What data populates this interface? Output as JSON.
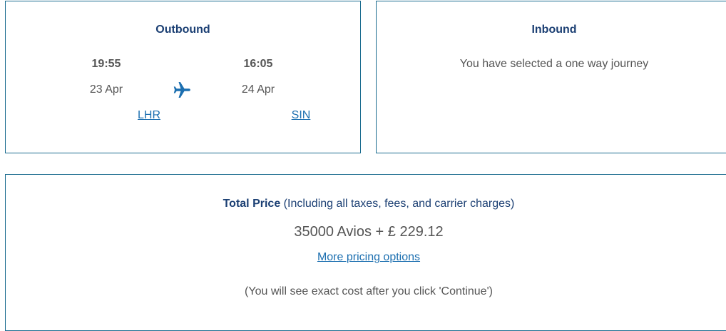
{
  "outbound": {
    "title": "Outbound",
    "departure": {
      "time": "19:55",
      "date": "23 Apr",
      "airport": "LHR"
    },
    "arrival": {
      "time": "16:05",
      "date": "24 Apr",
      "airport": "SIN"
    },
    "icon": "airplane-icon"
  },
  "inbound": {
    "title": "Inbound",
    "message": "You have selected a one way journey"
  },
  "price": {
    "label": "Total Price",
    "note": "(Including all taxes, fees, and carrier charges)",
    "amount": "35000 Avios + £ 229.12",
    "more_options": "More pricing options",
    "cost_note": "(You will see exact cost after you click 'Continue')"
  },
  "colors": {
    "border": "#1b6c8f",
    "heading": "#1b3f73",
    "link": "#1c6fb0",
    "text": "#555555"
  }
}
